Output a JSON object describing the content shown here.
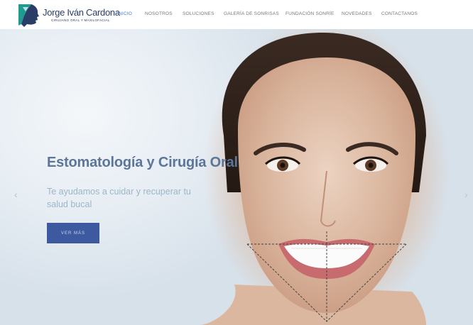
{
  "brand": {
    "name": "Jorge Iván Cardona",
    "tagline": "CIRUJANO ORAL Y MAXILOFACIAL"
  },
  "nav": {
    "items": [
      {
        "label": "INICIO",
        "active": true
      },
      {
        "label": "NOSOTROS",
        "active": false
      },
      {
        "label": "SOLUCIONES",
        "active": false
      },
      {
        "label": "GALERÍA DE SONRISAS",
        "active": false
      },
      {
        "label": "FUNDACIÓN SONRÍE",
        "active": false
      },
      {
        "label": "NOVEDADES",
        "active": false
      },
      {
        "label": "CONTACTANOS",
        "active": false
      }
    ]
  },
  "hero": {
    "title": "Estomatología y Cirugía Oral",
    "subtitle": "Te ayudamos a cuidar y recuperar tu salud bucal",
    "button_label": "VER MÁS",
    "prev_icon": "chevron-left-icon",
    "next_icon": "chevron-right-icon"
  },
  "colors": {
    "brand_navy": "#2a3d66",
    "brand_teal": "#1f9a8f",
    "nav_active": "#4a7bd0",
    "button_bg": "#3d5aa1",
    "title": "#5c7598",
    "subtitle": "#9bb7c9"
  }
}
